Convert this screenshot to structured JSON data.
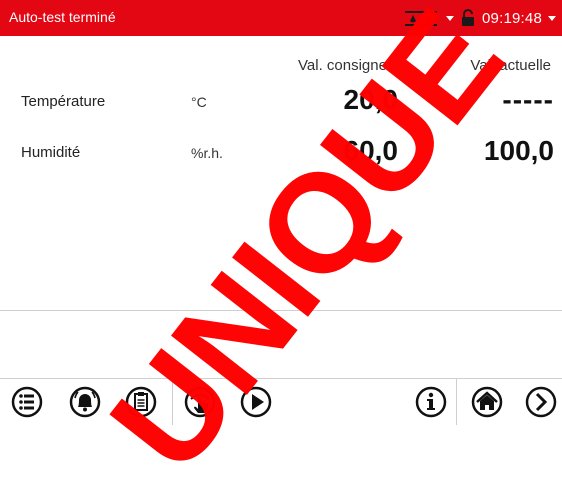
{
  "header": {
    "status_text": "Auto-test terminé",
    "time": "09:19:48",
    "background_color": "#e30613",
    "icons": [
      "door-humidity-icon",
      "dropdown-chevron-icon",
      "lock-icon",
      "dropdown-chevron-icon"
    ]
  },
  "table": {
    "col_setpoint": "Val. consigne",
    "col_actual": "Val. actuelle",
    "rows": [
      {
        "label": "Température",
        "unit": "°C",
        "setpoint": "20,0",
        "actual": "-----"
      },
      {
        "label": "Humidité",
        "unit": "%r.h.",
        "setpoint": "60,0",
        "actual": "100,0"
      }
    ]
  },
  "toolbar": {
    "buttons": [
      "menu-icon",
      "alarm-icon",
      "clipboard-icon",
      "touch-icon",
      "play-icon",
      "info-icon",
      "home-icon",
      "next-icon"
    ]
  },
  "watermark": {
    "text": "UNIQUE",
    "color": "#ff0000"
  }
}
